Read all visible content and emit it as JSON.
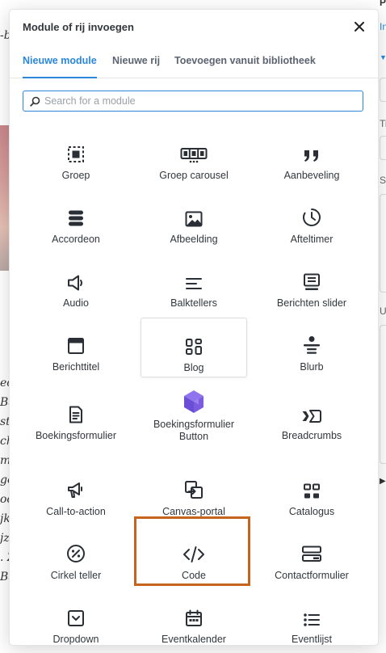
{
  "background": {
    "left_fragments": [
      "-b",
      "ec",
      "Ba",
      "st",
      "ch",
      "m",
      "ge",
      "oo",
      "jk",
      "jz",
      ". Z",
      "Ba"
    ],
    "right_fragments": [
      "P",
      "In",
      "Ti",
      "Sa",
      "U"
    ]
  },
  "modal": {
    "title": "Module of rij invoegen",
    "close_label": "×",
    "tabs": [
      {
        "label": "Nieuwe module",
        "active": true
      },
      {
        "label": "Nieuwe rij",
        "active": false
      },
      {
        "label": "Toevoegen vanuit bibliotheek",
        "active": false
      }
    ],
    "search": {
      "placeholder": "Search for a module",
      "value": ""
    },
    "modules": [
      {
        "label": "Groep",
        "icon": "group-icon"
      },
      {
        "label": "Groep carousel",
        "icon": "group-carousel-icon"
      },
      {
        "label": "Aanbeveling",
        "icon": "quote-icon"
      },
      {
        "label": "Accordeon",
        "icon": "accordion-icon"
      },
      {
        "label": "Afbeelding",
        "icon": "image-icon"
      },
      {
        "label": "Afteltimer",
        "icon": "clock-icon"
      },
      {
        "label": "Audio",
        "icon": "speaker-icon"
      },
      {
        "label": "Balktellers",
        "icon": "bar-counters-icon"
      },
      {
        "label": "Berichten slider",
        "icon": "post-slider-icon"
      },
      {
        "label": "Berichttitel",
        "icon": "post-title-icon"
      },
      {
        "label": "Blog",
        "icon": "blog-icon"
      },
      {
        "label": "Blurb",
        "icon": "blurb-icon"
      },
      {
        "label": "Boekingsformulier",
        "icon": "booking-form-icon"
      },
      {
        "label": "Boekingsformulier Button",
        "icon": "booking-button-icon"
      },
      {
        "label": "Breadcrumbs",
        "icon": "breadcrumbs-icon"
      },
      {
        "label": "Call-to-action",
        "icon": "megaphone-icon"
      },
      {
        "label": "Canvas-portal",
        "icon": "canvas-portal-icon"
      },
      {
        "label": "Catalogus",
        "icon": "catalog-icon"
      },
      {
        "label": "Cirkel teller",
        "icon": "circle-counter-icon"
      },
      {
        "label": "Code",
        "icon": "code-icon"
      },
      {
        "label": "Contactformulier",
        "icon": "contact-form-icon"
      },
      {
        "label": "Dropdown",
        "icon": "dropdown-icon"
      },
      {
        "label": "Eventkalender",
        "icon": "calendar-icon"
      },
      {
        "label": "Eventlijst",
        "icon": "list-icon"
      }
    ],
    "hovered_module": "Blog",
    "highlighted_module": "Code",
    "colors": {
      "accent": "#2b87da",
      "highlight": "#c5641d",
      "booking_icon": "#7b5ce0"
    }
  }
}
